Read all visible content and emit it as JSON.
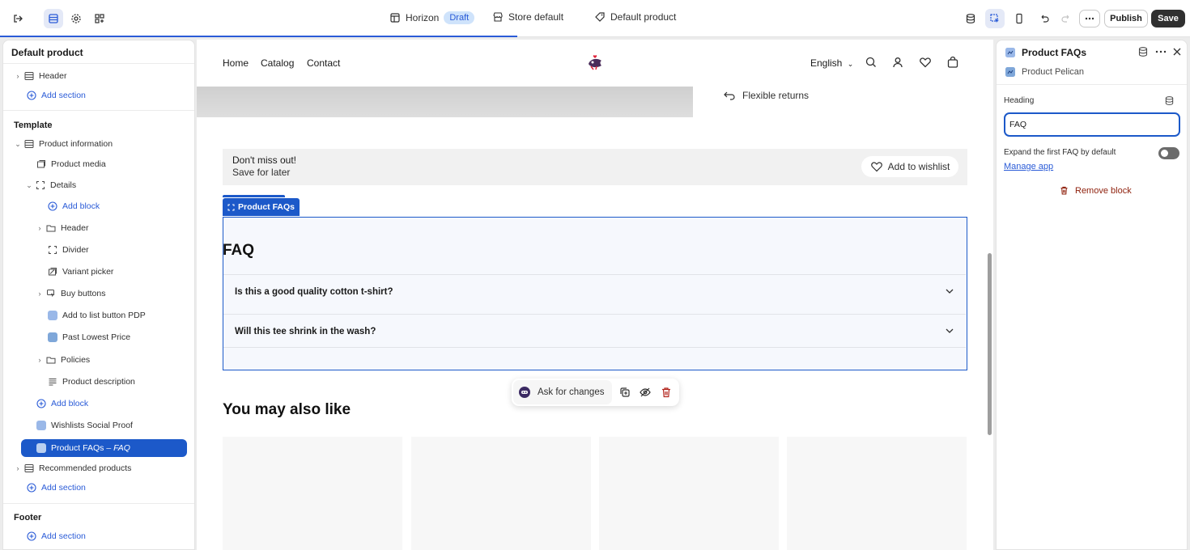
{
  "topbar": {
    "theme_name": "Horizon",
    "theme_status": "Draft",
    "store": "Store default",
    "template": "Default product",
    "publish_label": "Publish",
    "save_label": "Save"
  },
  "left": {
    "title": "Default product",
    "header_section": "Header",
    "add_section": "Add section",
    "template_group": "Template",
    "product_information": "Product information",
    "product_media": "Product media",
    "details": "Details",
    "add_block": "Add block",
    "header_block": "Header",
    "divider": "Divider",
    "variant_picker": "Variant picker",
    "buy_buttons": "Buy buttons",
    "add_to_list": "Add to list button PDP",
    "past_lowest": "Past Lowest Price",
    "policies": "Policies",
    "product_description": "Product description",
    "wishlists_social": "Wishlists Social Proof",
    "product_faqs": "Product FAQs",
    "product_faqs_suffix": "– FAQ",
    "recommended": "Recommended products",
    "footer_group": "Footer"
  },
  "preview": {
    "nav": [
      "Home",
      "Catalog",
      "Contact"
    ],
    "language": "English",
    "returns": "Flexible returns",
    "banner_title": "Don't miss out!",
    "banner_sub": "Save for later",
    "wishlist_btn": "Add to wishlist",
    "block_tag": "Product FAQs",
    "faq_heading": "FAQ",
    "faqs": [
      "Is this a good quality cotton t-shirt?",
      "Will this tee shrink in the wash?"
    ],
    "ask_changes": "Ask for changes",
    "also_like": "You may also like"
  },
  "right": {
    "title": "Product FAQs",
    "app_name": "Product Pelican",
    "heading_label": "Heading",
    "heading_value": "FAQ",
    "expand_label": "Expand the first FAQ by default",
    "expand_value": false,
    "manage_app": "Manage app",
    "remove_block": "Remove block"
  },
  "colors": {
    "accent": "#1c59c9",
    "destructive": "#8e1f0b"
  }
}
